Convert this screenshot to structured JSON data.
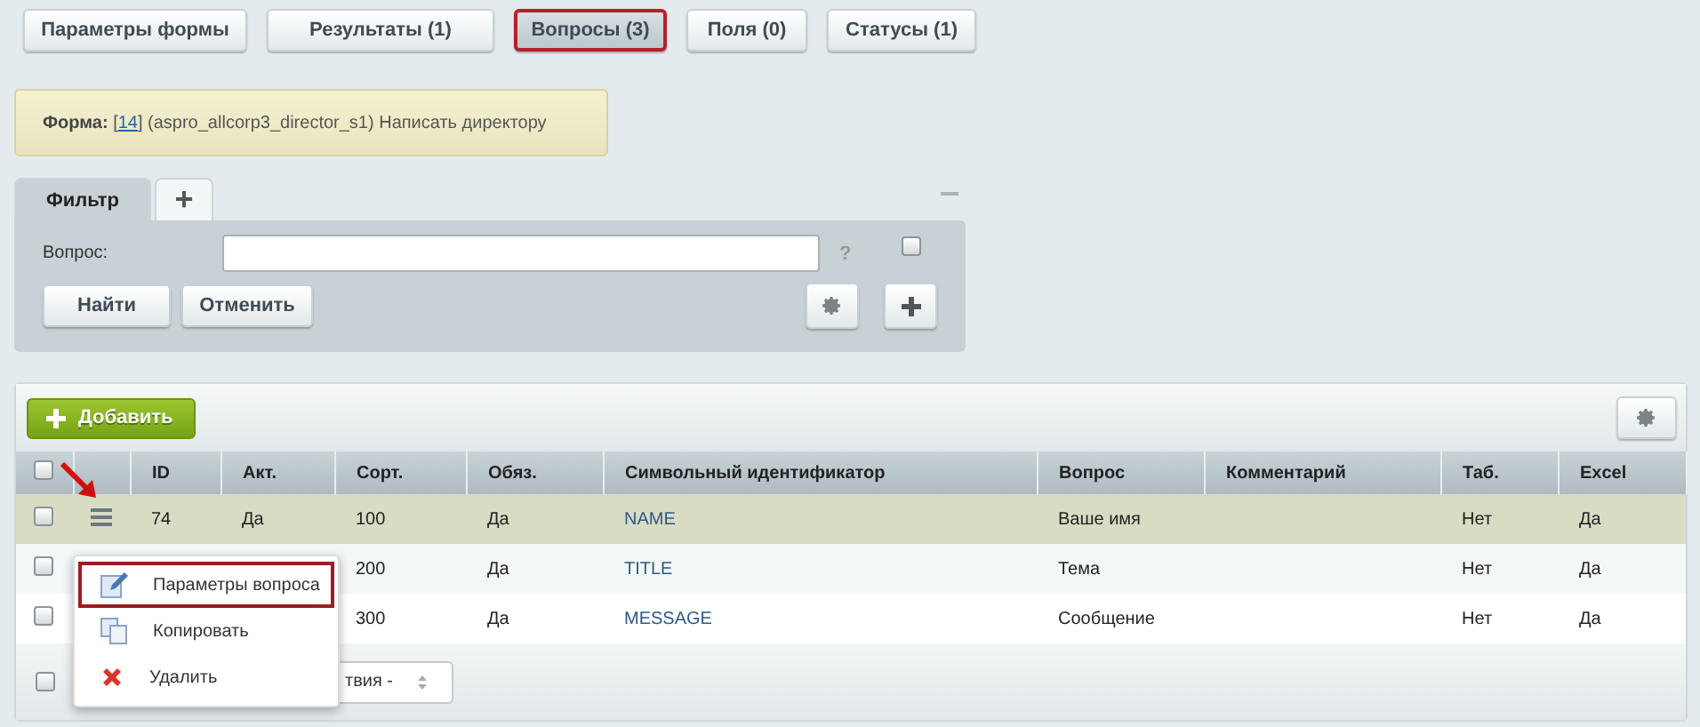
{
  "top_tabs": [
    {
      "label": "Параметры формы",
      "selected": false
    },
    {
      "label": "Результаты (1)",
      "selected": false
    },
    {
      "label": "Вопросы (3)",
      "selected": true
    },
    {
      "label": "Поля (0)",
      "selected": false
    },
    {
      "label": "Статусы (1)",
      "selected": false
    }
  ],
  "info": {
    "label": "Форма:",
    "open": "[",
    "link": "14",
    "close": "]",
    "text": " (aspro_allcorp3_director_s1) Написать директору"
  },
  "filter": {
    "tabs": [
      {
        "label": "Фильтр",
        "selected": true,
        "kind": "text"
      },
      {
        "label": "+",
        "selected": false,
        "kind": "add"
      }
    ],
    "field_label": "Вопрос:",
    "help": "?",
    "enabled": false,
    "buttons": [
      "Найти",
      "Отменить"
    ]
  },
  "table": {
    "add_button": "Добавить",
    "columns": [
      "ID",
      "Акт.",
      "Сорт.",
      "Обяз.",
      "Символьный идентификатор",
      "Вопрос",
      "Комментарий",
      "Таб.",
      "Excel"
    ],
    "rows": [
      {
        "selected": true,
        "checked": false,
        "cells": [
          "74",
          "Да",
          "100",
          "Да",
          "NAME",
          "Ваше имя",
          "",
          "Нет",
          "Да"
        ]
      },
      {
        "selected": false,
        "checked": false,
        "cells": [
          "",
          "",
          "200",
          "Да",
          "TITLE",
          "Тема",
          "",
          "Нет",
          "Да"
        ]
      },
      {
        "selected": false,
        "checked": false,
        "cells": [
          "",
          "",
          "300",
          "Да",
          "MESSAGE",
          "Сообщение",
          "",
          "Нет",
          "Да"
        ]
      }
    ],
    "all_checked": false,
    "footer_checked": false,
    "action_select": "твия -"
  },
  "context_menu": [
    {
      "label": "Параметры вопроса",
      "selected": true,
      "kind": "edit"
    },
    {
      "label": "Копировать",
      "selected": false,
      "kind": "copy"
    },
    {
      "label": "Удалить",
      "selected": false,
      "kind": "delete"
    }
  ]
}
